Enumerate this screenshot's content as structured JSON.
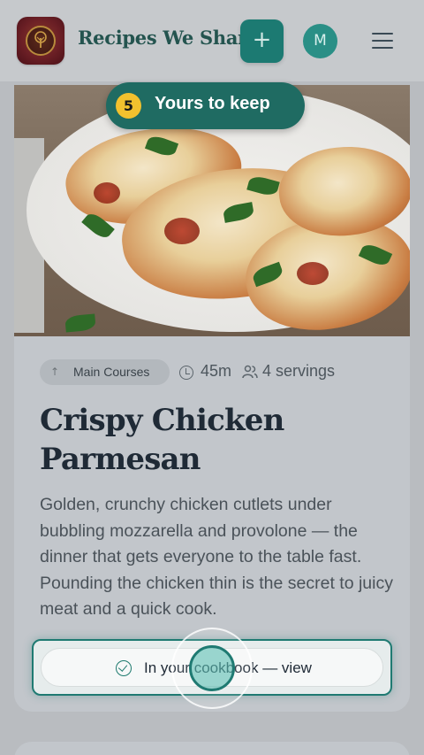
{
  "header": {
    "brand": "Recipes We Share",
    "add_label": "+",
    "avatar_initial": "M"
  },
  "tour": {
    "step": "5",
    "label": "Yours to keep"
  },
  "recipe": {
    "category": "Main Courses",
    "time": "45m",
    "servings": "4 servings",
    "title": "Crispy Chicken Parmesan",
    "description": "Golden, crunchy chicken cutlets under bubbling mozzarella and provolone — the dinner that gets everyone to the table fast. Pounding the chicken thin is the secret to juicy meat and a quick cook.",
    "cta": "In your cookbook — view"
  },
  "colors": {
    "accent": "#1f7a72",
    "badge": "#f2c12e",
    "brand_text": "#24544f"
  }
}
